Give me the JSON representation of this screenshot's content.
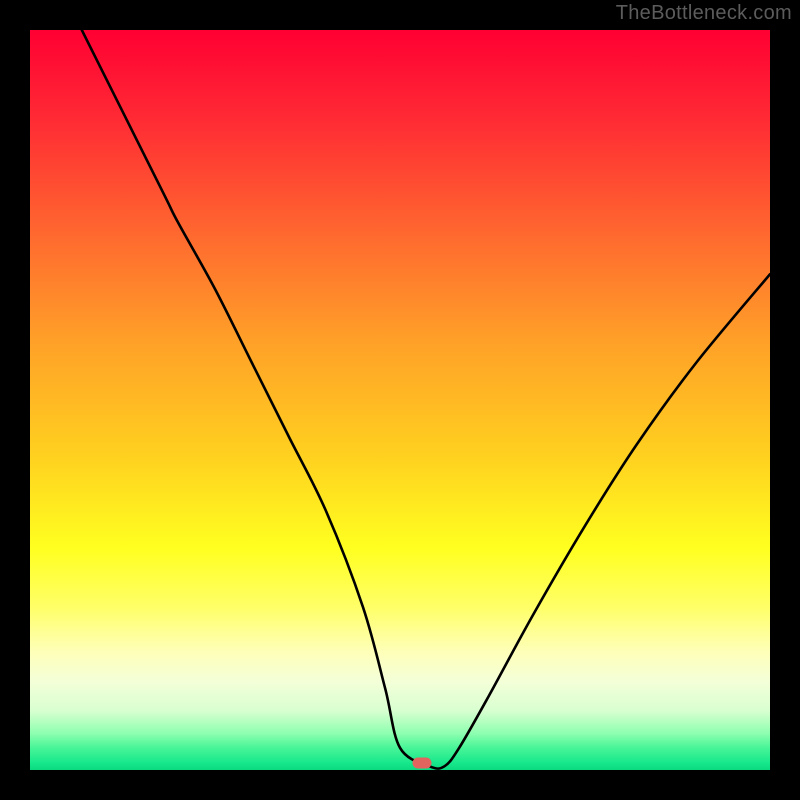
{
  "watermark": "TheBottleneck.com",
  "marker": {
    "x_pct": 53.0,
    "y_pct": 99.0
  },
  "chart_data": {
    "type": "line",
    "title": "",
    "xlabel": "",
    "ylabel": "",
    "xlim": [
      0,
      100
    ],
    "ylim": [
      0,
      100
    ],
    "series": [
      {
        "name": "bottleneck-curve",
        "x": [
          7,
          10,
          18,
          20,
          25,
          30,
          35,
          40,
          45,
          48,
          50,
          54,
          56,
          58,
          62,
          68,
          75,
          82,
          90,
          100
        ],
        "y": [
          100,
          94,
          78,
          74,
          65,
          55,
          45,
          35,
          22,
          11,
          3,
          0.5,
          0.5,
          3,
          10,
          21,
          33,
          44,
          55,
          67
        ]
      }
    ],
    "gradient_stops": [
      {
        "pct": 0,
        "color": "#ff0033"
      },
      {
        "pct": 12,
        "color": "#ff2a34"
      },
      {
        "pct": 28,
        "color": "#ff6a2f"
      },
      {
        "pct": 42,
        "color": "#ffa028"
      },
      {
        "pct": 58,
        "color": "#ffd21f"
      },
      {
        "pct": 70,
        "color": "#ffff20"
      },
      {
        "pct": 78,
        "color": "#ffff68"
      },
      {
        "pct": 84,
        "color": "#feffb8"
      },
      {
        "pct": 88,
        "color": "#f4ffd8"
      },
      {
        "pct": 92,
        "color": "#d8ffd0"
      },
      {
        "pct": 95,
        "color": "#8fffb0"
      },
      {
        "pct": 97,
        "color": "#48f598"
      },
      {
        "pct": 99,
        "color": "#18e88c"
      },
      {
        "pct": 100,
        "color": "#0bd980"
      }
    ]
  }
}
